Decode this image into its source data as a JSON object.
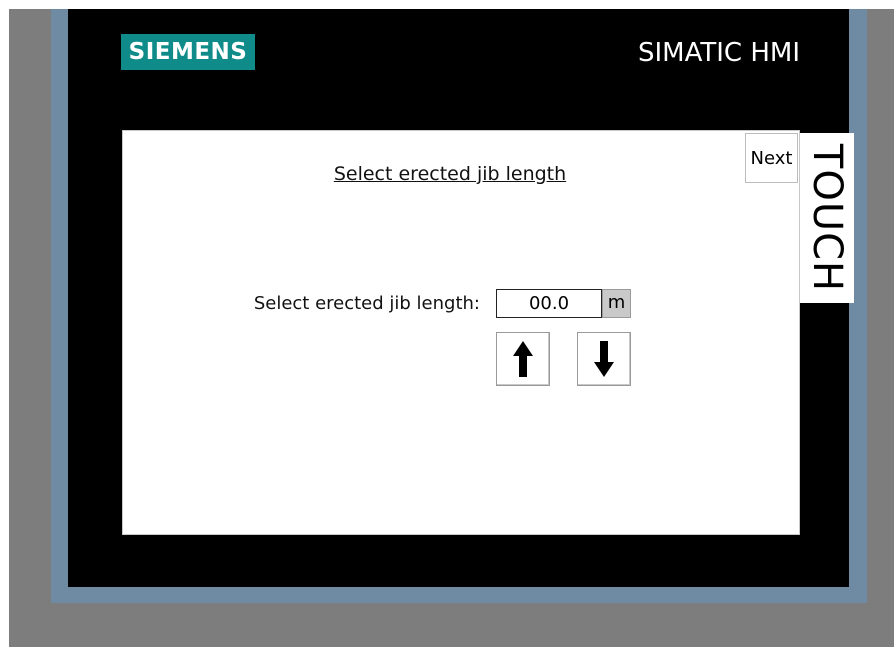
{
  "header": {
    "logo_text": "SIEMENS",
    "brand_title": "SIMATIC HMI",
    "side_label": "TOUCH"
  },
  "screen": {
    "title": "Select erected jib length",
    "next_label": "Next",
    "field": {
      "label": "Select erected jib length:",
      "value": "00.0",
      "unit": "m"
    },
    "buttons": {
      "increase_icon": "arrow-up-icon",
      "decrease_icon": "arrow-down-icon"
    }
  },
  "colors": {
    "outer_background": "#7d7d7d",
    "bezel_frame": "#6f8aa3",
    "bezel": "#000000",
    "logo_background": "#0f8c8a",
    "screen_background": "#ffffff",
    "unit_background": "#c9c9c9"
  }
}
